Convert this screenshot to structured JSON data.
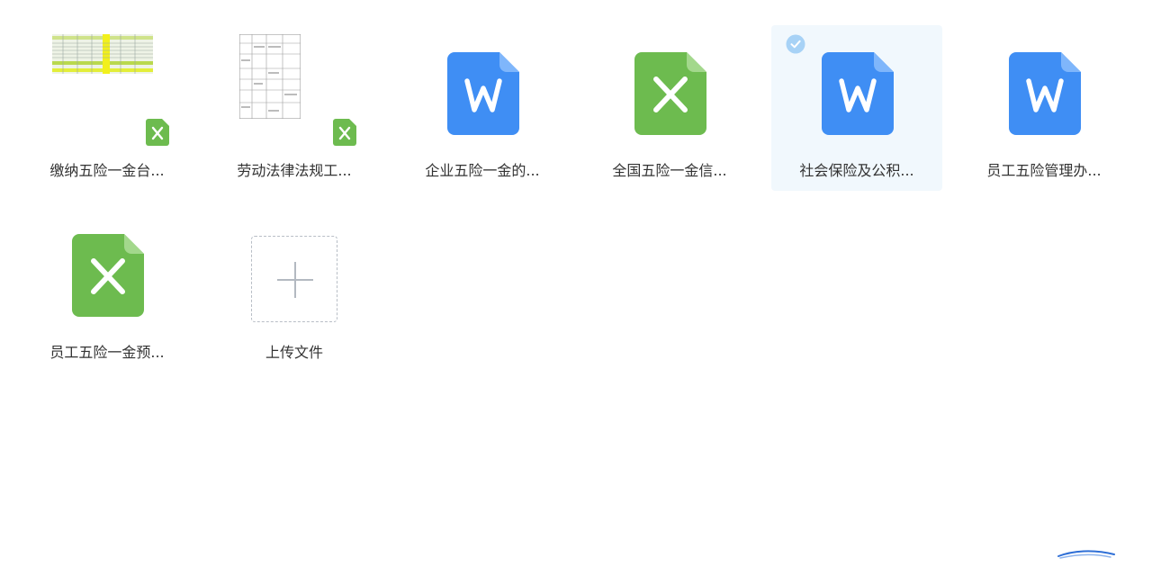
{
  "files": [
    {
      "name": "缴纳五险一金台...",
      "type": "xlsx",
      "thumbnail": "spreadsheet-preview",
      "selected": false
    },
    {
      "name": "劳动法律法规工...",
      "type": "xlsx",
      "thumbnail": "form-preview",
      "selected": false
    },
    {
      "name": "企业五险一金的...",
      "type": "docx",
      "thumbnail": "word-icon",
      "selected": false
    },
    {
      "name": "全国五险一金信...",
      "type": "xlsx",
      "thumbnail": "excel-icon",
      "selected": false
    },
    {
      "name": "社会保险及公积...",
      "type": "docx",
      "thumbnail": "word-icon",
      "selected": true
    },
    {
      "name": "员工五险管理办...",
      "type": "docx",
      "thumbnail": "word-icon",
      "selected": false
    },
    {
      "name": "员工五险一金预...",
      "type": "xlsx",
      "thumbnail": "excel-icon",
      "selected": false
    }
  ],
  "upload": {
    "label": "上传文件",
    "icon": "plus-icon"
  },
  "colors": {
    "word_blue": "#3f8ef4",
    "excel_green": "#6dbb4f",
    "selected_bg": "#f1f8fd",
    "check_blue": "#a7d2f6",
    "text": "#333333"
  }
}
